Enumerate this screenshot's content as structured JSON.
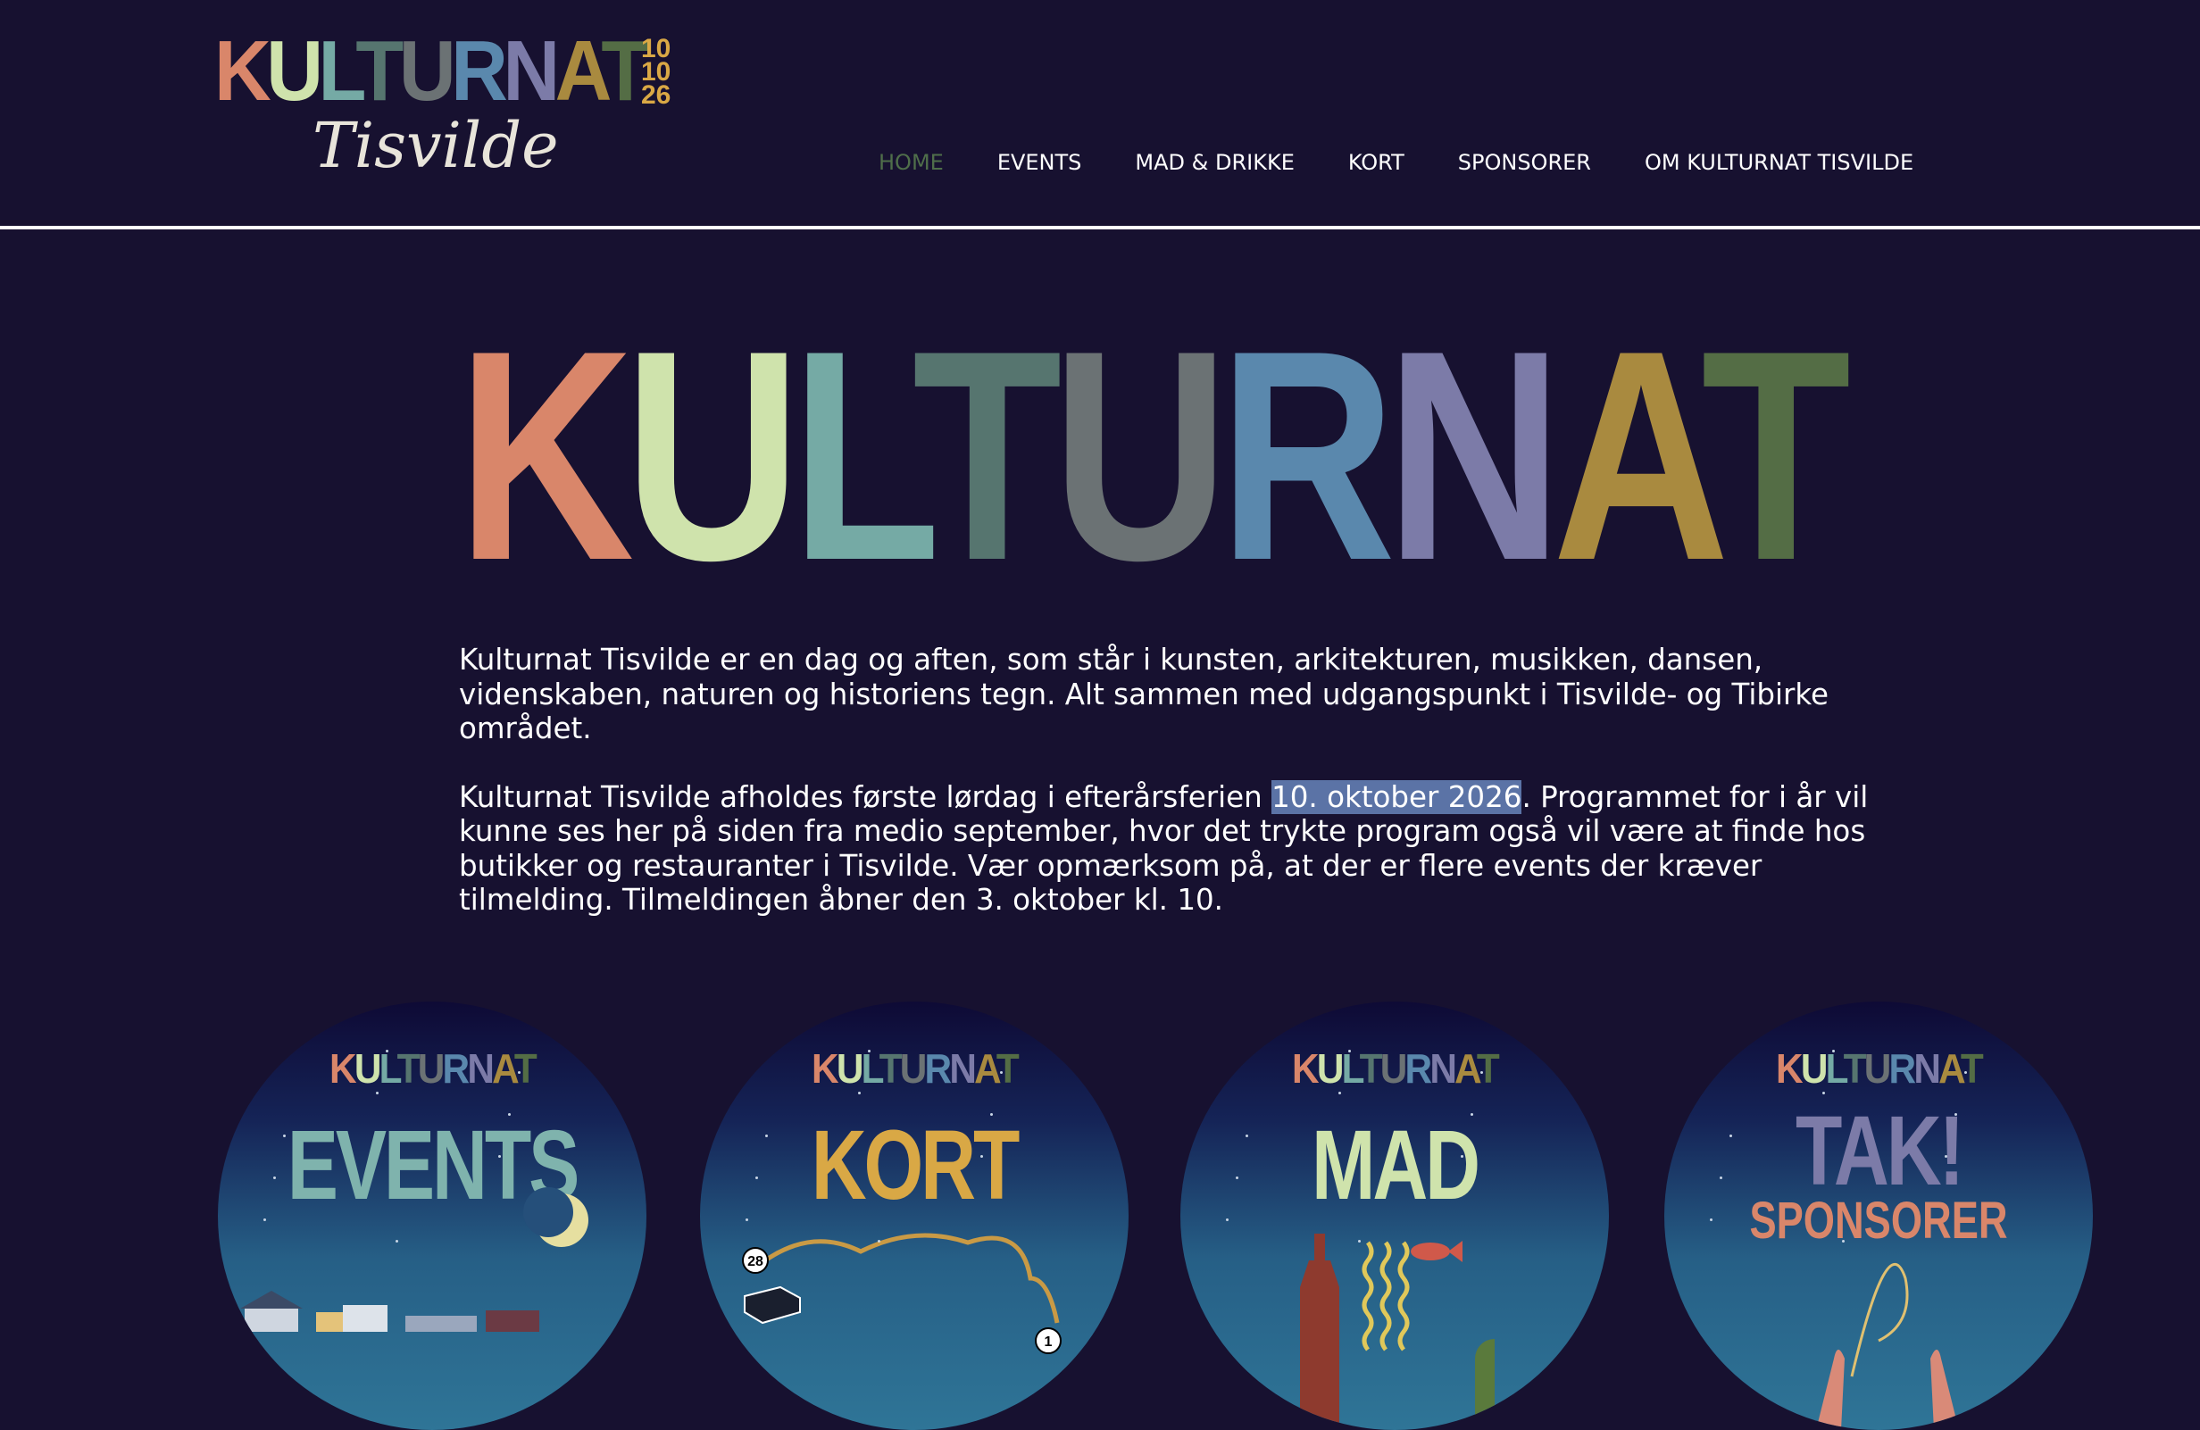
{
  "colors": {
    "background": "#171130",
    "nav_active": "#4f6e4a",
    "highlight": "#5b73a6",
    "letters": [
      "#d9866a",
      "#cfe3ac",
      "#75aaa5",
      "#56756f",
      "#6b7274",
      "#5a88ad",
      "#7c7ba8",
      "#a98a3f",
      "#546d45"
    ]
  },
  "logo": {
    "letters": [
      "K",
      "U",
      "L",
      "T",
      "U",
      "R",
      "N",
      "A",
      "T"
    ],
    "year_lines": [
      "10",
      "10",
      "26"
    ],
    "subtitle": "Tisvilde"
  },
  "nav": {
    "items": [
      {
        "label": "HOME",
        "active": true
      },
      {
        "label": "EVENTS",
        "active": false
      },
      {
        "label": "MAD & DRIKKE",
        "active": false
      },
      {
        "label": "KORT",
        "active": false
      },
      {
        "label": "SPONSORER",
        "active": false
      },
      {
        "label": "OM KULTURNAT TISVILDE",
        "active": false
      }
    ]
  },
  "hero": {
    "letters": [
      "K",
      "U",
      "L",
      "T",
      "U",
      "R",
      "N",
      "A",
      "T"
    ]
  },
  "intro": {
    "p1": "Kulturnat Tisvilde er en dag og aften, som står i kunsten, arkitekturen, musikken, dansen, videnskaben, naturen og historiens tegn. Alt sammen med udgangspunkt i Tisvilde- og Tibirke området.",
    "p2_before": "Kulturnat Tisvilde afholdes første lørdag i efterårsferien ",
    "p2_date": "10. oktober 2026",
    "p2_after": ". Programmet for i år vil kunne ses her på siden fra medio september, hvor det trykte program også vil være at finde hos butikker og restauranter i Tisvilde. Vær opmærksom på, at der er flere events der kræver tilmelding. Tilmeldingen åbner den 3. oktober kl. 10."
  },
  "tiles": [
    {
      "brand": "KULTURNAT",
      "title": "EVENTS",
      "title_color": "#7fb3ad",
      "subtitle": "",
      "icon": "moon-icon"
    },
    {
      "brand": "KULTURNAT",
      "title": "KORT",
      "title_color": "#d9a845",
      "subtitle": "",
      "icon": "map-route-icon",
      "markers": [
        "28",
        "1"
      ]
    },
    {
      "brand": "KULTURNAT",
      "title": "MAD",
      "title_color": "#cfe3ac",
      "subtitle": "",
      "icon": "bottle-fish-icon"
    },
    {
      "brand": "KULTURNAT",
      "title": "TAK!",
      "title_color": "#7c7ba8",
      "subtitle": "SPONSORER",
      "subtitle_color": "#d9866a",
      "icon": "hands-icon"
    }
  ]
}
